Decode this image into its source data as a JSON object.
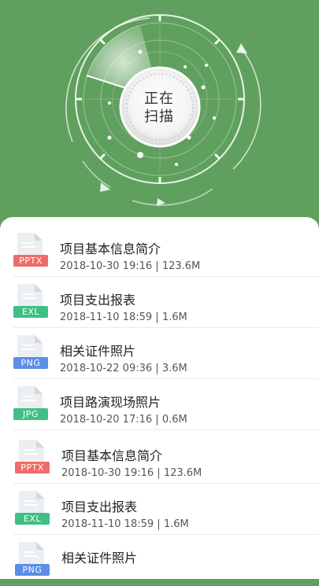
{
  "scanner": {
    "status_label_line1": "正在",
    "status_label_line2": "扫描",
    "background_color": "#60a05e"
  },
  "files": [
    {
      "name": "项目基本信息简介",
      "date": "2018-10-30 19:16",
      "size": "123.6M",
      "type": "PPTX",
      "type_color": "#f06b6b",
      "icon": "pptx-file-icon"
    },
    {
      "name": "项目支出报表",
      "date": "2018-11-10 18:59",
      "size": "1.6M",
      "type": "EXL",
      "type_color": "#3fbf84",
      "icon": "excel-file-icon"
    },
    {
      "name": "相关证件照片",
      "date": "2018-10-22 09:36",
      "size": "3.6M",
      "type": "PNG",
      "type_color": "#5b8ee6",
      "icon": "png-file-icon"
    },
    {
      "name": "项目路演现场照片",
      "date": "2018-10-20 17:16",
      "size": "0.6M",
      "type": "JPG",
      "type_color": "#3fbf84",
      "icon": "jpg-file-icon"
    },
    {
      "name": "项目基本信息简介",
      "date": "2018-10-30 19:16",
      "size": "123.6M",
      "type": "PPTX",
      "type_color": "#f06b6b",
      "icon": "pptx-file-icon"
    },
    {
      "name": "项目支出报表",
      "date": "2018-11-10 18:59",
      "size": "1.6M",
      "type": "EXL",
      "type_color": "#3fbf84",
      "icon": "excel-file-icon"
    },
    {
      "name": "相关证件照片",
      "date": "",
      "size": "",
      "type": "PNG",
      "type_color": "#5b8ee6",
      "icon": "png-file-icon"
    }
  ]
}
